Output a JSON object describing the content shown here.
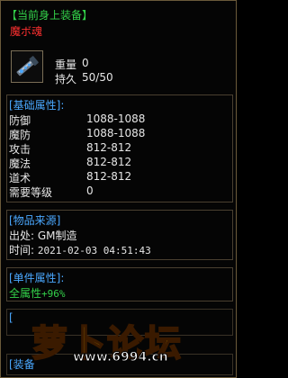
{
  "header": {
    "title": "【当前身上装备】",
    "item_name": "魔ボ魂"
  },
  "item": {
    "icon": "weapon-icon",
    "weight_label": "重量",
    "weight_value": "0",
    "durability_label": "持久",
    "durability_value": "50/50"
  },
  "base_attrs": {
    "heading": "[基础属性]:",
    "rows": [
      {
        "label": "防御",
        "value": "1088-1088"
      },
      {
        "label": "魔防",
        "value": "1088-1088"
      },
      {
        "label": "攻击",
        "value": "812-812"
      },
      {
        "label": "魔法",
        "value": "812-812"
      },
      {
        "label": "道术",
        "value": "812-812"
      },
      {
        "label": "需要等级",
        "value": "0"
      }
    ]
  },
  "source": {
    "heading": "[物品来源]",
    "origin_label": "出处:",
    "origin_value": "GM制造",
    "time_label": "时间:",
    "time_value": "2021-02-03 04:51:43"
  },
  "single_attrs": {
    "heading": "[单件属性]:",
    "line": "全属性",
    "bonus": "+96%"
  },
  "partial": {
    "bracket_1": "[",
    "bracket_2": "[装备"
  },
  "watermark": {
    "logo_text": "萝卜论坛",
    "url": "www.6994.cn"
  },
  "colors": {
    "green": "#33d24a",
    "red": "#ff3030",
    "blue": "#4aa8ff",
    "gold": "#ffc400"
  }
}
